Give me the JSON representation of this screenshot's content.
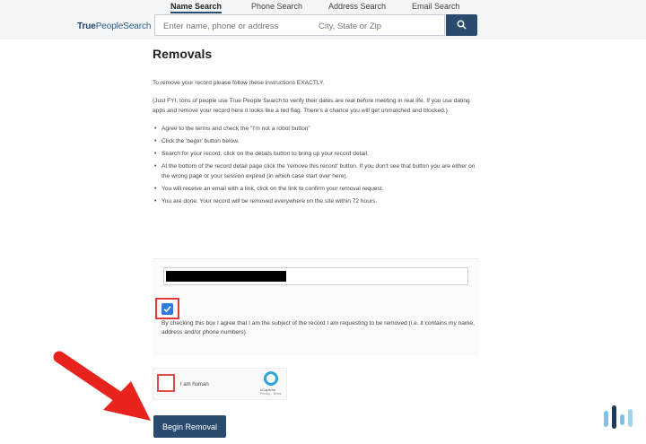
{
  "header": {
    "logo": {
      "part1": "True",
      "part2": "PeopleSearch"
    },
    "tabs": [
      {
        "label": "Name Search",
        "active": true
      },
      {
        "label": "Phone Search",
        "active": false
      },
      {
        "label": "Address Search",
        "active": false
      },
      {
        "label": "Email Search",
        "active": false
      }
    ],
    "search": {
      "name_placeholder": "Enter name, phone or address",
      "location_placeholder": "City, State or Zip",
      "button_icon": "search-icon"
    }
  },
  "page": {
    "title": "Removals",
    "intro": "To remove your record please follow these instructions EXACTLY.",
    "fyi": "(Just FYI, tons of people use True People Search to verify their dates are real before meeting in real life. If you use dating apps and remove your record here it looks like a red flag. There's a chance you will get unmatched and blocked.)",
    "steps": [
      "Agree to the terms and check the \"I'm not a robot button\"",
      "Click the 'begin' button below.",
      "Search for your record, click on the details button to bring up your record detail.",
      "At the bottom of the record detail page click the 'remove this record' button. If you don't see that button you are either on the wrong page or your session expired (in which case start over here).",
      "You will receive an email with a link, click on the link to confirm your removal request.",
      "You are done. Your record will be removed everywhere on the site within 72 hours."
    ]
  },
  "form": {
    "agree_checked": true,
    "agree_text": "By checking this box I agree that I am the subject of the record I am requesting to be removed (i.e. it contains my name, address and/or phone numbers).",
    "captcha": {
      "label": "I am human",
      "brand": "hCaptcha",
      "links": "Privacy - Terms"
    },
    "submit_label": "Begin Removal"
  },
  "colors": {
    "primary": "#2b4a6f",
    "highlight": "#e03a3a",
    "checkbox": "#2f7be0"
  }
}
